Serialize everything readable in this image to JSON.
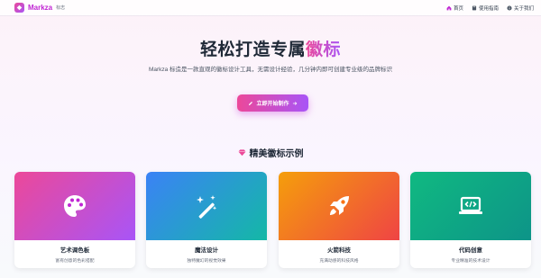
{
  "nav": {
    "brand_name": "Markza",
    "brand_tag": "标志",
    "links": [
      {
        "label": "首页",
        "icon": "home-icon"
      },
      {
        "label": "使用指南",
        "icon": "book-icon"
      },
      {
        "label": "关于我们",
        "icon": "info-icon"
      }
    ]
  },
  "hero": {
    "title_main": "轻松打造专属",
    "title_accent": "徽标",
    "description": "Markza 标造是一款直观的徽标设计工具，无需设计经验，几分钟内即可创建专业级的品牌标识",
    "cta_label": "立即开始制作"
  },
  "section": {
    "title": "精美徽标示例"
  },
  "cards": [
    {
      "name": "艺术调色板",
      "desc": "富有创意的色彩搭配",
      "icon": "palette-icon"
    },
    {
      "name": "魔法设计",
      "desc": "独特魔幻的视觉效果",
      "icon": "magic-wand-icon"
    },
    {
      "name": "火箭科技",
      "desc": "充满动感的科技风格",
      "icon": "rocket-icon"
    },
    {
      "name": "代码创意",
      "desc": "专业精准的技术设计",
      "icon": "code-laptop-icon"
    }
  ],
  "colors": {
    "accent_pink": "#ec4899",
    "accent_purple": "#a855f7"
  }
}
